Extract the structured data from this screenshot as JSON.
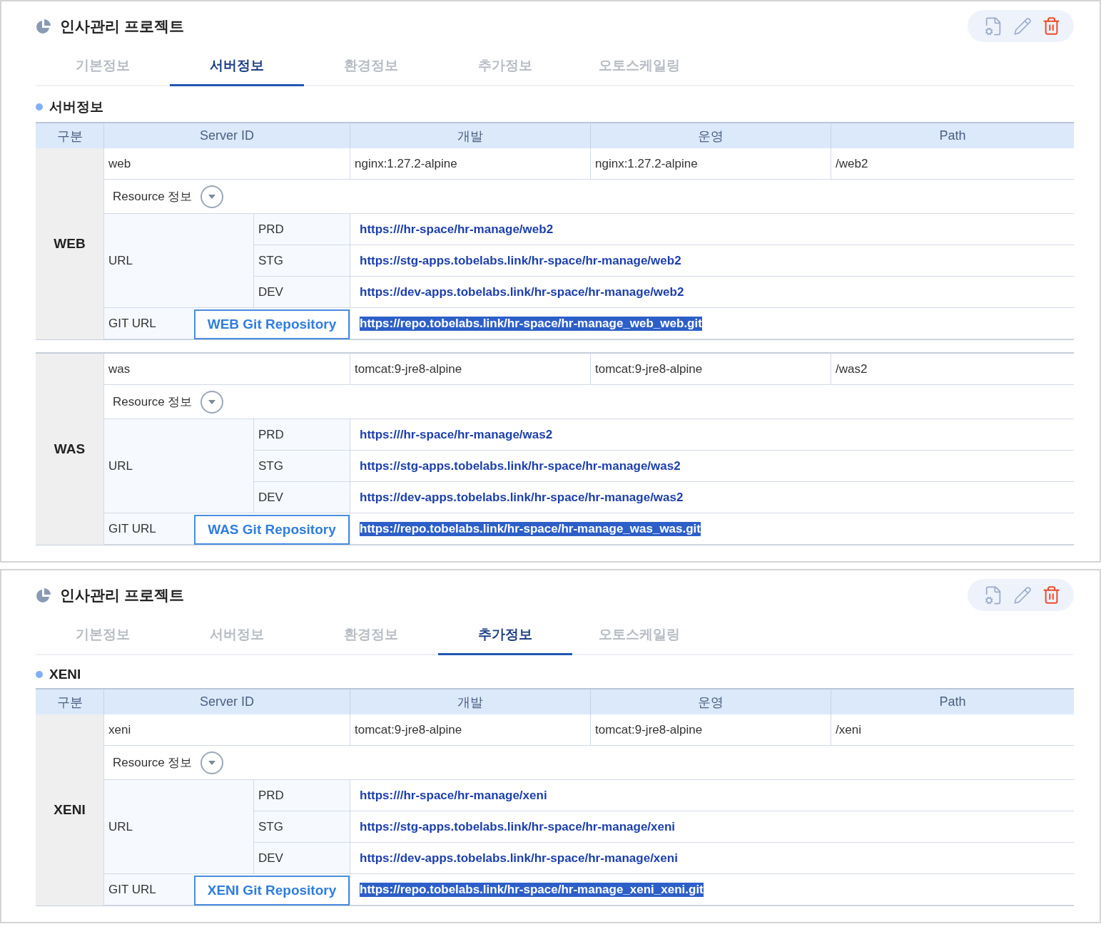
{
  "panels": [
    {
      "title": "인사관리 프로젝트",
      "tabs": [
        {
          "label": "기본정보",
          "selected": false
        },
        {
          "label": "서버정보",
          "selected": true
        },
        {
          "label": "환경정보",
          "selected": false
        },
        {
          "label": "추가정보",
          "selected": false
        },
        {
          "label": "오토스케일링",
          "selected": false
        }
      ],
      "section_title": "서버정보",
      "columns": [
        "구분",
        "Server ID",
        "개발",
        "운영",
        "Path"
      ],
      "groups": [
        {
          "category": "WEB",
          "server_id": "web",
          "dev": "nginx:1.27.2-alpine",
          "prd": "nginx:1.27.2-alpine",
          "path": "/web2",
          "resource_label": "Resource 정보",
          "url_label": "URL",
          "urls": [
            {
              "env": "PRD",
              "url": "https:///hr-space/hr-manage/web2"
            },
            {
              "env": "STG",
              "url": "https://stg-apps.tobelabs.link/hr-space/hr-manage/web2"
            },
            {
              "env": "DEV",
              "url": "https://dev-apps.tobelabs.link/hr-space/hr-manage/web2"
            }
          ],
          "git_label": "GIT URL",
          "git_button": "WEB Git Repository",
          "git_url": "https://repo.tobelabs.link/hr-space/hr-manage_web_web.git",
          "git_url_selected": true
        },
        {
          "category": "WAS",
          "server_id": "was",
          "dev": "tomcat:9-jre8-alpine",
          "prd": "tomcat:9-jre8-alpine",
          "path": "/was2",
          "resource_label": "Resource 정보",
          "url_label": "URL",
          "urls": [
            {
              "env": "PRD",
              "url": "https:///hr-space/hr-manage/was2"
            },
            {
              "env": "STG",
              "url": "https://stg-apps.tobelabs.link/hr-space/hr-manage/was2"
            },
            {
              "env": "DEV",
              "url": "https://dev-apps.tobelabs.link/hr-space/hr-manage/was2"
            }
          ],
          "git_label": "GIT URL",
          "git_button": "WAS Git Repository",
          "git_url": "https://repo.tobelabs.link/hr-space/hr-manage_was_was.git",
          "git_url_selected": true
        }
      ]
    },
    {
      "title": "인사관리 프로젝트",
      "tabs": [
        {
          "label": "기본정보",
          "selected": false
        },
        {
          "label": "서버정보",
          "selected": false
        },
        {
          "label": "환경정보",
          "selected": false
        },
        {
          "label": "추가정보",
          "selected": true
        },
        {
          "label": "오토스케일링",
          "selected": false
        }
      ],
      "section_title": "XENI",
      "columns": [
        "구분",
        "Server ID",
        "개발",
        "운영",
        "Path"
      ],
      "groups": [
        {
          "category": "XENI",
          "server_id": "xeni",
          "dev": "tomcat:9-jre8-alpine",
          "prd": "tomcat:9-jre8-alpine",
          "path": "/xeni",
          "resource_label": "Resource 정보",
          "url_label": "URL",
          "urls": [
            {
              "env": "PRD",
              "url": "https:///hr-space/hr-manage/xeni"
            },
            {
              "env": "STG",
              "url": "https://stg-apps.tobelabs.link/hr-space/hr-manage/xeni"
            },
            {
              "env": "DEV",
              "url": "https://dev-apps.tobelabs.link/hr-space/hr-manage/xeni"
            }
          ],
          "git_label": "GIT URL",
          "git_button": "XENI Git Repository",
          "git_url": "https://repo.tobelabs.link/hr-space/hr-manage_xeni_xeni.git",
          "git_url_selected": true
        }
      ]
    }
  ]
}
